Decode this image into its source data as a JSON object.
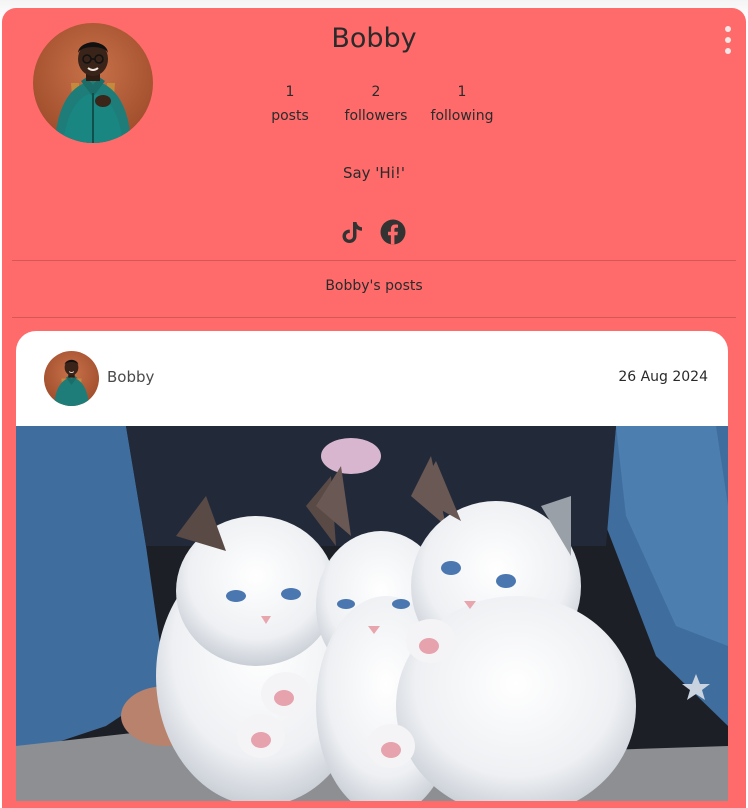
{
  "profile": {
    "username": "Bobby",
    "stats": [
      {
        "value": "1",
        "label": "posts"
      },
      {
        "value": "2",
        "label": "followers"
      },
      {
        "value": "1",
        "label": "following"
      }
    ],
    "bio": "Say 'Hi!'",
    "socials": [
      "tiktok-icon",
      "facebook-icon"
    ],
    "posts_heading": "Bobby's posts"
  },
  "post": {
    "author": "Bobby",
    "date": "26 Aug 2024",
    "image": "three-white-kittens-photo"
  },
  "colors": {
    "card_bg": "#ff6b6b",
    "text": "#2a2a2a",
    "post_bg": "#ffffff",
    "icon": "#333333"
  }
}
